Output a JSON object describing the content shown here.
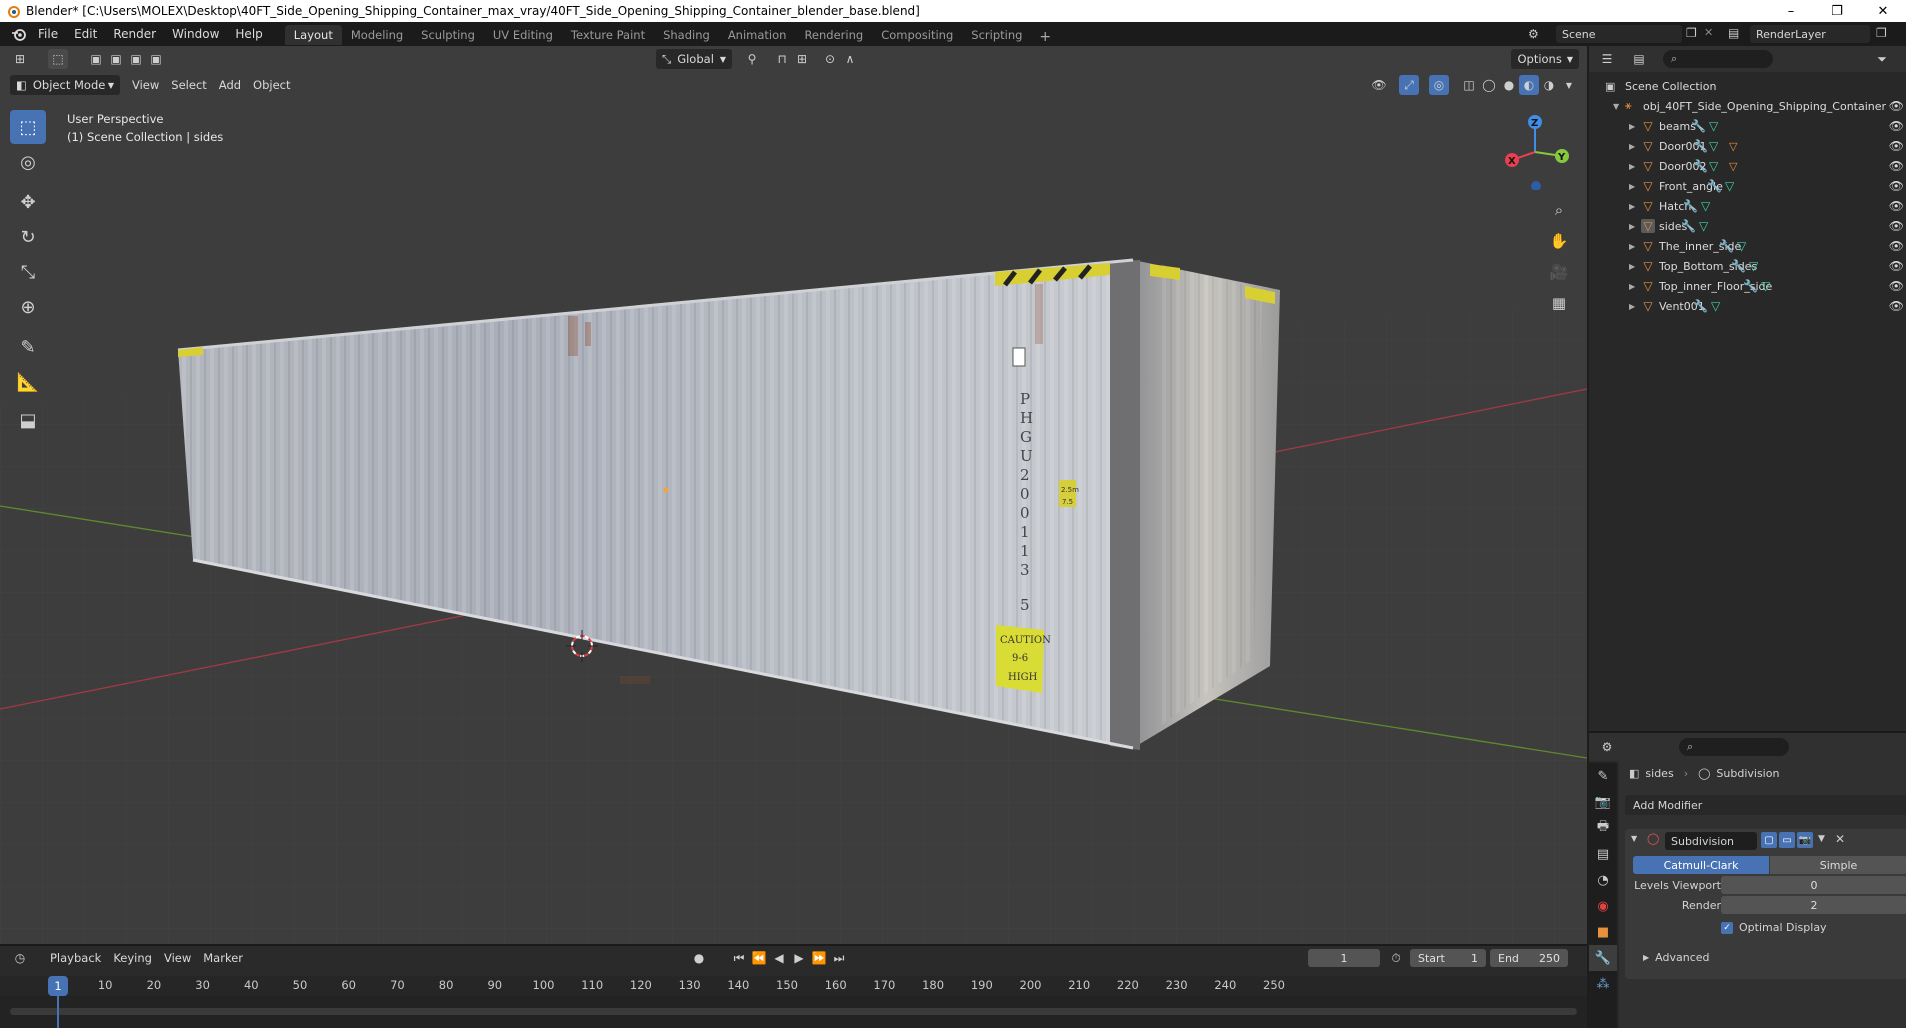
{
  "window": {
    "title": "Blender* [C:\\Users\\MOLEX\\Desktop\\40FT_Side_Opening_Shipping_Container_max_vray/40FT_Side_Opening_Shipping_Container_blender_base.blend]",
    "minimize": "–",
    "maximize": "❐",
    "close": "✕"
  },
  "menu": [
    "File",
    "Edit",
    "Render",
    "Window",
    "Help"
  ],
  "workspaces": [
    "Layout",
    "Modeling",
    "Sculpting",
    "UV Editing",
    "Texture Paint",
    "Shading",
    "Animation",
    "Rendering",
    "Compositing",
    "Scripting"
  ],
  "active_workspace": "Layout",
  "scene": {
    "name": "Scene",
    "view_layer": "RenderLayer"
  },
  "viewport": {
    "transform_orientation": "Global",
    "options_label": "Options",
    "mode": "Object Mode",
    "menus": [
      "View",
      "Select",
      "Add",
      "Object"
    ],
    "perspective_label": "User Perspective",
    "collection_label": "(1) Scene Collection | sides",
    "gizmo": {
      "x": "X",
      "y": "Y",
      "z": "Z"
    },
    "container_text": {
      "vertical_code": [
        "P",
        "H",
        "G",
        "U",
        "2",
        "0",
        "0",
        "1",
        "1",
        "3",
        "5"
      ],
      "caution": [
        "CAUTION",
        "9-6",
        "HIGH"
      ],
      "sticker": [
        "2.5m",
        "7.5"
      ]
    }
  },
  "timeline": {
    "menus": [
      "Playback",
      "Keying",
      "View",
      "Marker"
    ],
    "current_frame": "1",
    "start_label": "Start",
    "start": "1",
    "end_label": "End",
    "end": "250",
    "ticks": [
      "10",
      "20",
      "30",
      "40",
      "50",
      "60",
      "70",
      "80",
      "90",
      "100",
      "110",
      "120",
      "130",
      "140",
      "150",
      "160",
      "170",
      "180",
      "190",
      "200",
      "210",
      "220",
      "230",
      "240",
      "250"
    ],
    "current_tick": "1"
  },
  "outliner": {
    "root": "Scene Collection",
    "object_collection": "obj_40FT_Side_Opening_Shipping_Container",
    "items": [
      {
        "name": "beams"
      },
      {
        "name": "Door001"
      },
      {
        "name": "Door002"
      },
      {
        "name": "Front_angle"
      },
      {
        "name": "Hatch"
      },
      {
        "name": "sides"
      },
      {
        "name": "The_inner_side"
      },
      {
        "name": "Top_Bottom_sides"
      },
      {
        "name": "Top_inner_Floor_side"
      },
      {
        "name": "Vent001"
      }
    ]
  },
  "properties": {
    "object": "sides",
    "modifier_breadcrumb": "Subdivision",
    "add_modifier": "Add Modifier",
    "modifier_name": "Subdivision",
    "algo_options": [
      "Catmull-Clark",
      "Simple"
    ],
    "algo_selected": "Catmull-Clark",
    "levels_viewport_label": "Levels Viewport",
    "levels_viewport": "0",
    "render_label": "Render",
    "render": "2",
    "optimal_display_label": "Optimal Display",
    "advanced_label": "Advanced"
  },
  "colors": {
    "accent": "#4772b3",
    "axis_x": "#e8404f",
    "axis_y": "#86c93e",
    "axis_z": "#3f8ee8",
    "object_orange": "#e8913c",
    "mesh_teal": "#3fd0b0"
  }
}
